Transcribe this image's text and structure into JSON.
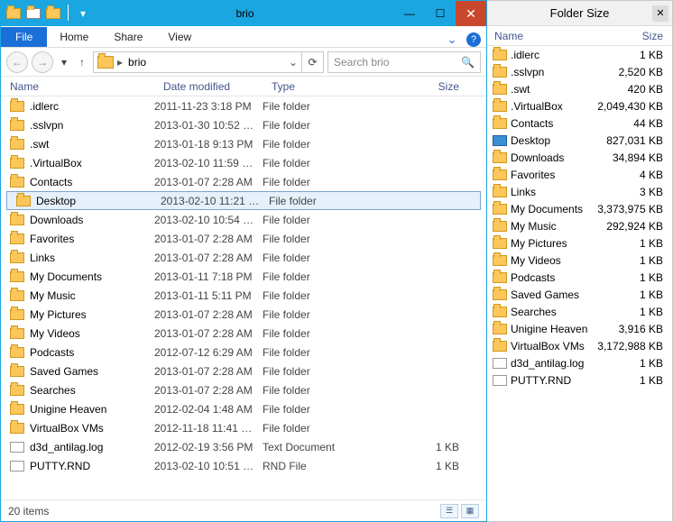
{
  "window": {
    "title": "brio",
    "tabs": {
      "file": "File",
      "home": "Home",
      "share": "Share",
      "view": "View"
    },
    "nav": {
      "crumb": "brio",
      "search_placeholder": "Search brio"
    },
    "columns": {
      "name": "Name",
      "date": "Date modified",
      "type": "Type",
      "size": "Size"
    },
    "status": "20 items",
    "selected_index": 5
  },
  "files": [
    {
      "name": ".idlerc",
      "date": "2011-11-23 3:18 PM",
      "type": "File folder",
      "size": "",
      "icon": "folder"
    },
    {
      "name": ".sslvpn",
      "date": "2013-01-30 10:52 …",
      "type": "File folder",
      "size": "",
      "icon": "folder"
    },
    {
      "name": ".swt",
      "date": "2013-01-18 9:13 PM",
      "type": "File folder",
      "size": "",
      "icon": "folder"
    },
    {
      "name": ".VirtualBox",
      "date": "2013-02-10 11:59 …",
      "type": "File folder",
      "size": "",
      "icon": "folder"
    },
    {
      "name": "Contacts",
      "date": "2013-01-07 2:28 AM",
      "type": "File folder",
      "size": "",
      "icon": "folder"
    },
    {
      "name": "Desktop",
      "date": "2013-02-10 11:21 …",
      "type": "File folder",
      "size": "",
      "icon": "folder"
    },
    {
      "name": "Downloads",
      "date": "2013-02-10 10:54 …",
      "type": "File folder",
      "size": "",
      "icon": "folder"
    },
    {
      "name": "Favorites",
      "date": "2013-01-07 2:28 AM",
      "type": "File folder",
      "size": "",
      "icon": "folder"
    },
    {
      "name": "Links",
      "date": "2013-01-07 2:28 AM",
      "type": "File folder",
      "size": "",
      "icon": "folder"
    },
    {
      "name": "My Documents",
      "date": "2013-01-11 7:18 PM",
      "type": "File folder",
      "size": "",
      "icon": "folder"
    },
    {
      "name": "My Music",
      "date": "2013-01-11 5:11 PM",
      "type": "File folder",
      "size": "",
      "icon": "folder"
    },
    {
      "name": "My Pictures",
      "date": "2013-01-07 2:28 AM",
      "type": "File folder",
      "size": "",
      "icon": "folder"
    },
    {
      "name": "My Videos",
      "date": "2013-01-07 2:28 AM",
      "type": "File folder",
      "size": "",
      "icon": "folder"
    },
    {
      "name": "Podcasts",
      "date": "2012-07-12 6:29 AM",
      "type": "File folder",
      "size": "",
      "icon": "folder"
    },
    {
      "name": "Saved Games",
      "date": "2013-01-07 2:28 AM",
      "type": "File folder",
      "size": "",
      "icon": "folder"
    },
    {
      "name": "Searches",
      "date": "2013-01-07 2:28 AM",
      "type": "File folder",
      "size": "",
      "icon": "folder"
    },
    {
      "name": "Unigine Heaven",
      "date": "2012-02-04 1:48 AM",
      "type": "File folder",
      "size": "",
      "icon": "folder"
    },
    {
      "name": "VirtualBox VMs",
      "date": "2012-11-18 11:41 …",
      "type": "File folder",
      "size": "",
      "icon": "folder"
    },
    {
      "name": "d3d_antilag.log",
      "date": "2012-02-19 3:56 PM",
      "type": "Text Document",
      "size": "1 KB",
      "icon": "file"
    },
    {
      "name": "PUTTY.RND",
      "date": "2013-02-10 10:51 …",
      "type": "RND File",
      "size": "1 KB",
      "icon": "file"
    }
  ],
  "side": {
    "title": "Folder Size",
    "columns": {
      "name": "Name",
      "size": "Size"
    },
    "items": [
      {
        "name": ".idlerc",
        "size": "1 KB",
        "icon": "folder"
      },
      {
        "name": ".sslvpn",
        "size": "2,520 KB",
        "icon": "folder"
      },
      {
        "name": ".swt",
        "size": "420 KB",
        "icon": "folder"
      },
      {
        "name": ".VirtualBox",
        "size": "2,049,430 KB",
        "icon": "folder"
      },
      {
        "name": "Contacts",
        "size": "44 KB",
        "icon": "folder"
      },
      {
        "name": "Desktop",
        "size": "827,031 KB",
        "icon": "desktop"
      },
      {
        "name": "Downloads",
        "size": "34,894 KB",
        "icon": "folder"
      },
      {
        "name": "Favorites",
        "size": "4 KB",
        "icon": "folder"
      },
      {
        "name": "Links",
        "size": "3 KB",
        "icon": "folder"
      },
      {
        "name": "My Documents",
        "size": "3,373,975 KB",
        "icon": "folder"
      },
      {
        "name": "My Music",
        "size": "292,924 KB",
        "icon": "folder"
      },
      {
        "name": "My Pictures",
        "size": "1 KB",
        "icon": "folder"
      },
      {
        "name": "My Videos",
        "size": "1 KB",
        "icon": "folder"
      },
      {
        "name": "Podcasts",
        "size": "1 KB",
        "icon": "folder"
      },
      {
        "name": "Saved Games",
        "size": "1 KB",
        "icon": "folder"
      },
      {
        "name": "Searches",
        "size": "1 KB",
        "icon": "folder"
      },
      {
        "name": "Unigine Heaven",
        "size": "3,916 KB",
        "icon": "folder"
      },
      {
        "name": "VirtualBox VMs",
        "size": "3,172,988 KB",
        "icon": "folder"
      },
      {
        "name": "d3d_antilag.log",
        "size": "1 KB",
        "icon": "file"
      },
      {
        "name": "PUTTY.RND",
        "size": "1 KB",
        "icon": "file"
      }
    ]
  }
}
